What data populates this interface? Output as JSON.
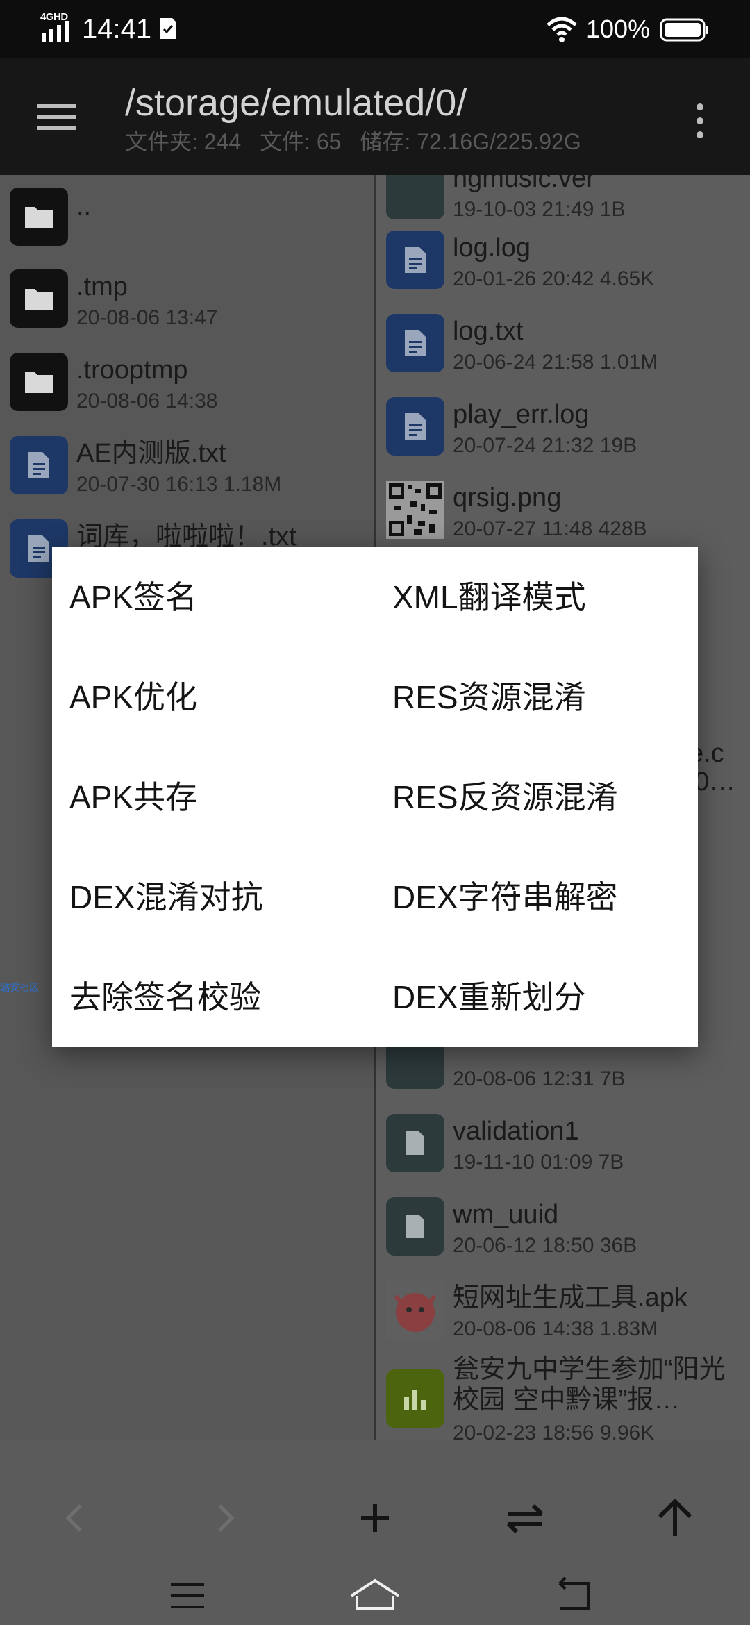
{
  "status_bar": {
    "network": "4GHD",
    "time": "14:41",
    "battery_text": "100%"
  },
  "toolbar": {
    "path": "/storage/emulated/0/",
    "folders": "文件夹: 244",
    "files": "文件: 65",
    "storage": "储存: 72.16G/225.92G"
  },
  "left_pane": {
    "items": [
      {
        "name": "..",
        "meta": "",
        "icon": "folder-icon"
      },
      {
        "name": ".tmp",
        "meta": "20-08-06 13:47",
        "icon": "folder-icon"
      },
      {
        "name": ".trooptmp",
        "meta": "20-08-06 14:38",
        "icon": "folder-icon"
      },
      {
        "name": "AE内测版.txt",
        "meta": "20-07-30 16:13  1.18M",
        "icon": "document-icon"
      },
      {
        "name": "词库，啦啦啦！.txt",
        "meta": "",
        "icon": "document-icon"
      }
    ],
    "side_link": "酷安社区"
  },
  "right_pane": {
    "items": [
      {
        "name": "ngmusic.ver",
        "meta": "19-10-03 21:49  1B",
        "icon": "file-icon"
      },
      {
        "name": "log.log",
        "meta": "20-01-26 20:42  4.65K",
        "icon": "document-icon"
      },
      {
        "name": "log.txt",
        "meta": "20-06-24 21:58  1.01M",
        "icon": "document-icon"
      },
      {
        "name": "play_err.log",
        "meta": "20-07-24 21:32  19B",
        "icon": "document-icon"
      },
      {
        "name": "qrsig.png",
        "meta": "20-07-27 11:48  428B",
        "icon": "qr-image-icon"
      },
      {
        "name": "e.c",
        "meta": "0…",
        "icon": ""
      },
      {
        "name": "",
        "meta": "20-08-06 12:31  7B",
        "icon": "file-icon"
      },
      {
        "name": "validation1",
        "meta": "19-11-10 01:09  7B",
        "icon": "file-icon"
      },
      {
        "name": "wm_uuid",
        "meta": "20-06-12 18:50  36B",
        "icon": "file-icon"
      },
      {
        "name": "短网址生成工具.apk",
        "meta": "20-08-06 14:38  1.83M",
        "icon": "apk-icon"
      },
      {
        "name": "瓮安九中学生参加“阳光校园 空中黔课”报…",
        "meta": "20-02-23 18:56  9.96K",
        "icon": "chart-doc-icon"
      }
    ]
  },
  "dialog": {
    "options": [
      {
        "label": "APK签名"
      },
      {
        "label": "XML翻译模式"
      },
      {
        "label": "APK优化"
      },
      {
        "label": "RES资源混淆"
      },
      {
        "label": "APK共存"
      },
      {
        "label": "RES反资源混淆"
      },
      {
        "label": "DEX混淆对抗"
      },
      {
        "label": "DEX字符串解密"
      },
      {
        "label": "去除签名校验"
      },
      {
        "label": "DEX重新划分"
      }
    ]
  },
  "bottom_toolbar": {
    "buttons": [
      "back-arrow-icon",
      "forward-arrow-icon",
      "add-icon",
      "swap-icon",
      "up-arrow-icon"
    ]
  },
  "system_nav": {
    "buttons": [
      "menu-icon",
      "home-icon",
      "back-icon"
    ]
  },
  "colors": {
    "toolbar_bg": "#171717",
    "dialog_bg": "#ffffff",
    "doc_icon": "#1d3867",
    "folder_icon": "#111111"
  }
}
